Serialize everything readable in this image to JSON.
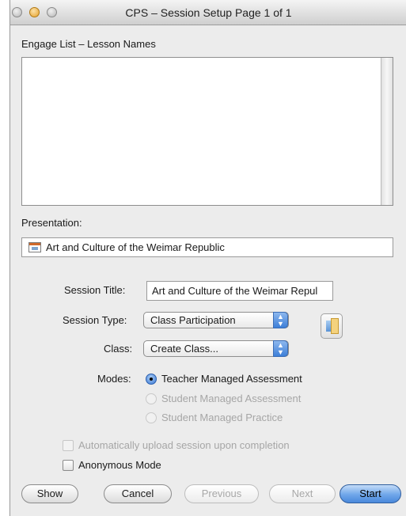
{
  "window": {
    "title": "CPS – Session Setup Page 1 of 1"
  },
  "engage": {
    "label": "Engage List – Lesson Names",
    "items": []
  },
  "presentation": {
    "label": "Presentation:",
    "value": "Art and Culture of the Weimar Republic",
    "icon": "presentation-icon"
  },
  "session_title": {
    "label": "Session Title:",
    "value": "Art and Culture of the Weimar Repul"
  },
  "session_type": {
    "label": "Session Type:",
    "selected": "Class Participation"
  },
  "class_select": {
    "label": "Class:",
    "selected": "Create Class..."
  },
  "modes": {
    "label": "Modes:",
    "options": [
      {
        "label": "Teacher Managed Assessment",
        "selected": true,
        "enabled": true
      },
      {
        "label": "Student Managed Assessment",
        "selected": false,
        "enabled": false
      },
      {
        "label": "Student Managed Practice",
        "selected": false,
        "enabled": false
      }
    ]
  },
  "options": {
    "auto_upload": {
      "label": "Automatically upload session upon completion",
      "checked": false,
      "enabled": false
    },
    "anonymous": {
      "label": "Anonymous Mode",
      "checked": false,
      "enabled": true
    }
  },
  "buttons": {
    "show": "Show",
    "cancel": "Cancel",
    "previous": "Previous",
    "next": "Next",
    "start": "Start"
  },
  "colors": {
    "accent": "#3d7fd8",
    "primary_button": "#6fa6ea",
    "disabled_text": "#a6a6a6"
  }
}
